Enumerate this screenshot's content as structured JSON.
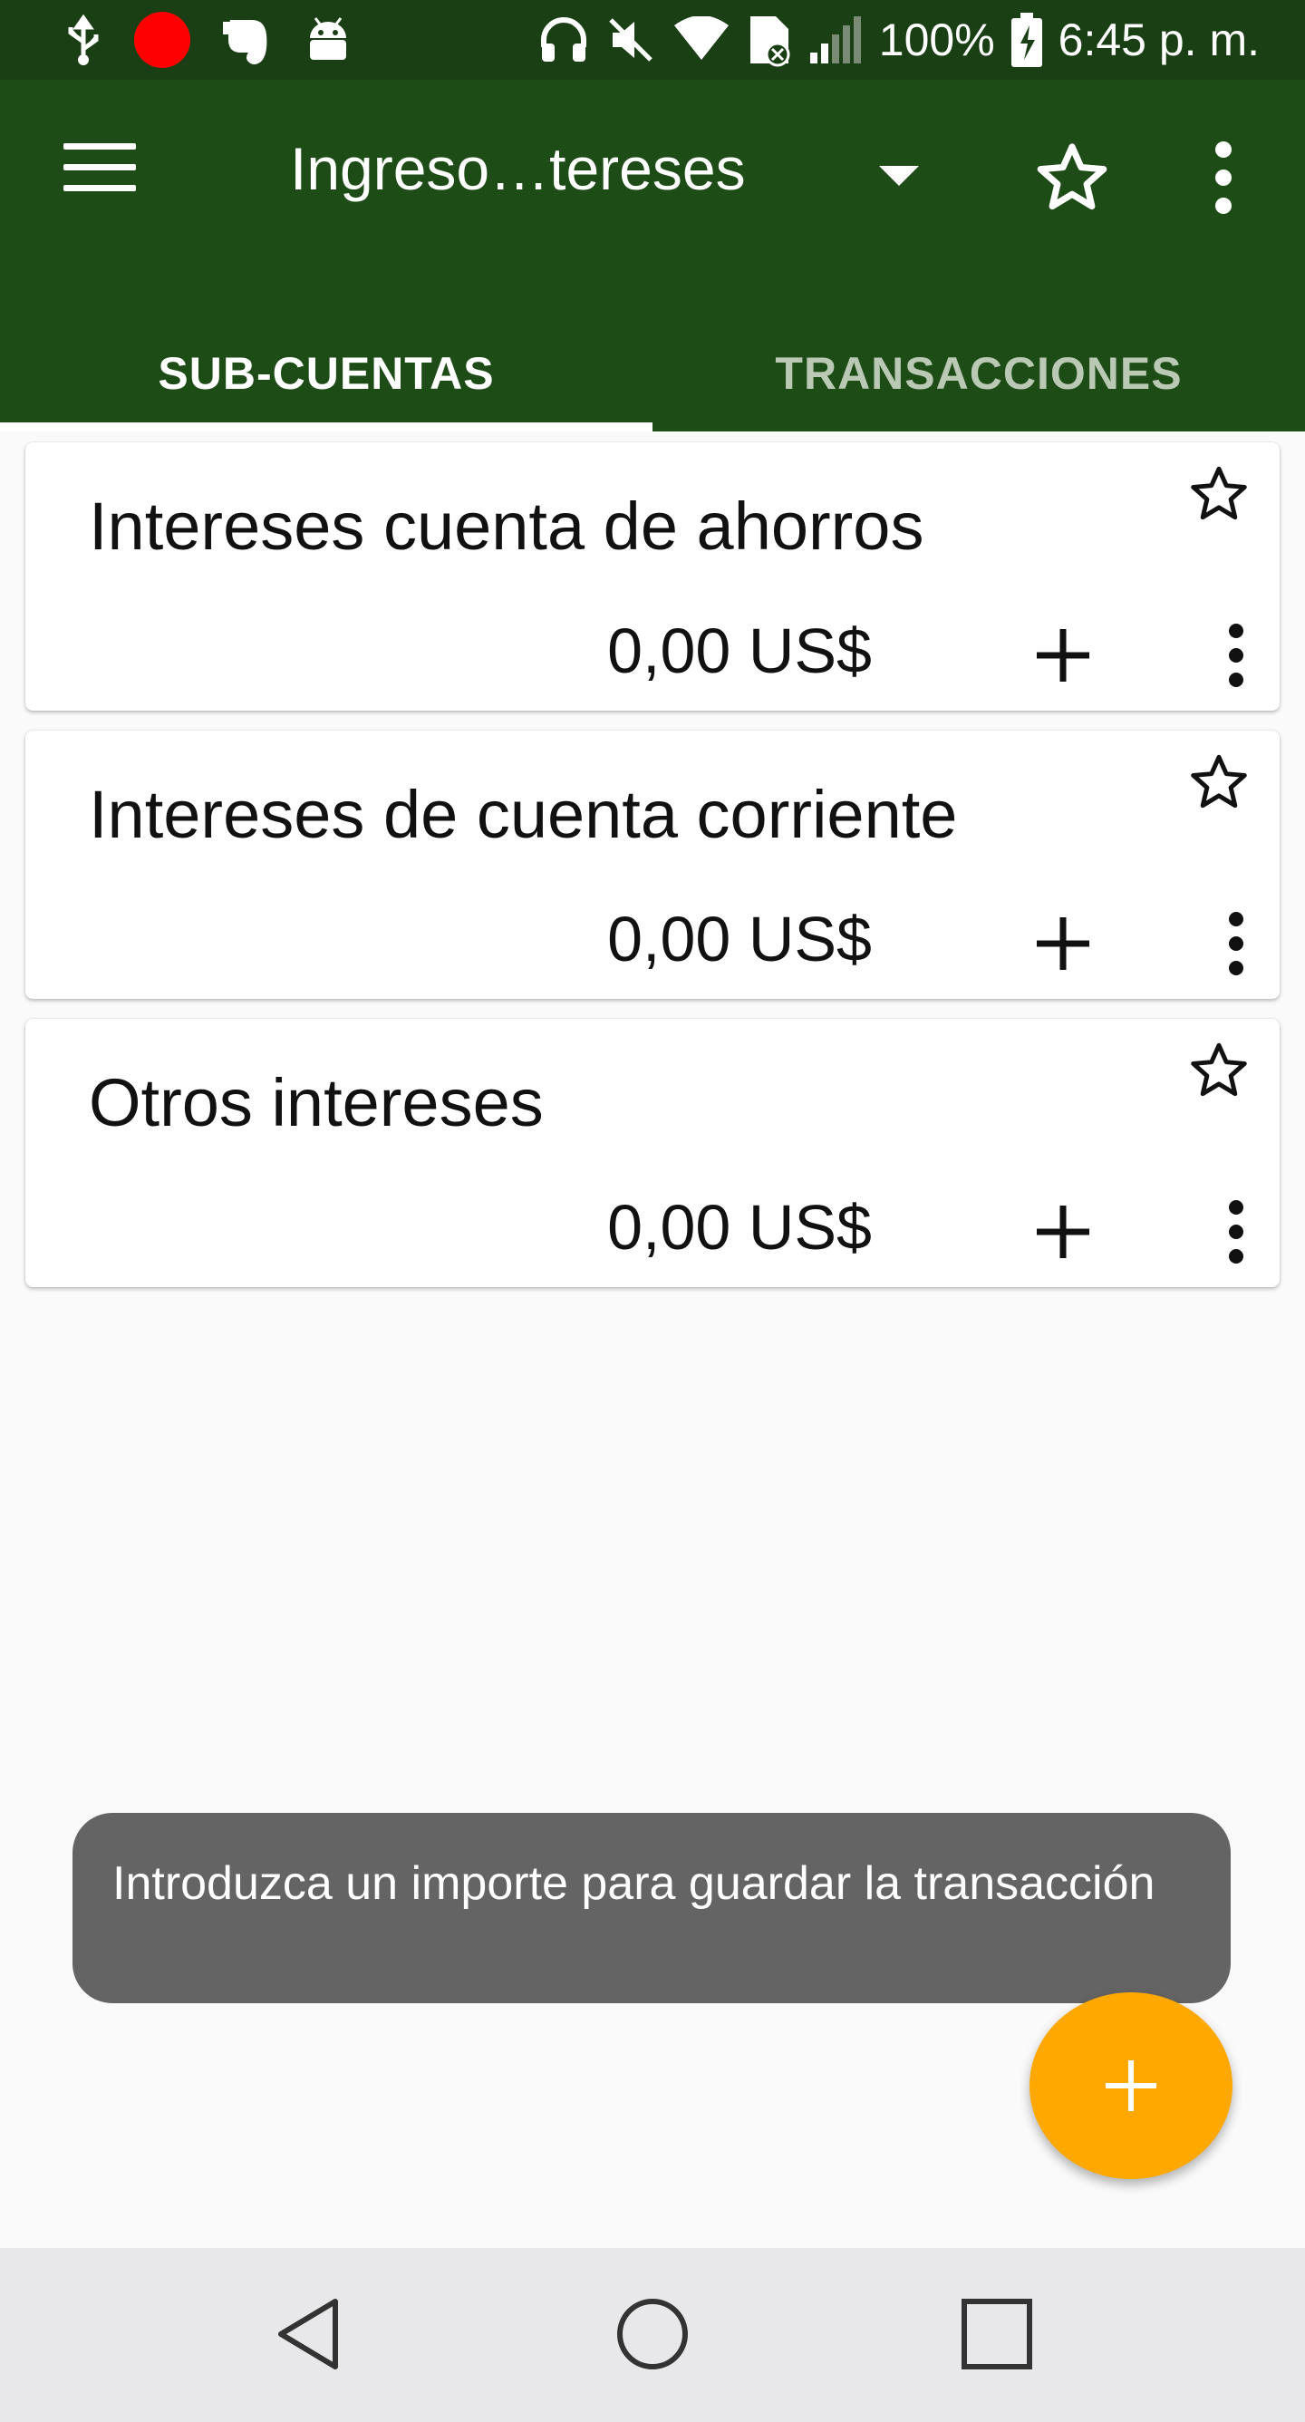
{
  "status_bar": {
    "battery": "100%",
    "time": "6:45 p. m."
  },
  "app_bar": {
    "title": "Ingreso…tereses"
  },
  "tabs": [
    {
      "label": "SUB-CUENTAS",
      "active": true
    },
    {
      "label": "TRANSACCIONES",
      "active": false
    }
  ],
  "accounts": [
    {
      "name": "Intereses cuenta de ahorros",
      "balance": "0,00 US$"
    },
    {
      "name": "Intereses de cuenta corriente",
      "balance": "0,00 US$"
    },
    {
      "name": "Otros intereses",
      "balance": "0,00 US$"
    }
  ],
  "toast": {
    "message": "Introduzca un importe para guardar la transacción"
  },
  "colors": {
    "app_bar": "#1e4c17",
    "status_bar": "#1a3f14",
    "fab": "#ffa800",
    "toast": "#646464"
  },
  "icons": [
    "usb-icon",
    "record-icon",
    "evernote-icon",
    "android-icon",
    "headphones-icon",
    "mute-icon",
    "wifi-icon",
    "no-sim-icon",
    "signal-icon",
    "battery-charging-icon",
    "menu-icon",
    "dropdown-icon",
    "star-outline-icon",
    "more-vert-icon",
    "plus-icon",
    "back-icon",
    "home-icon",
    "recents-icon"
  ]
}
